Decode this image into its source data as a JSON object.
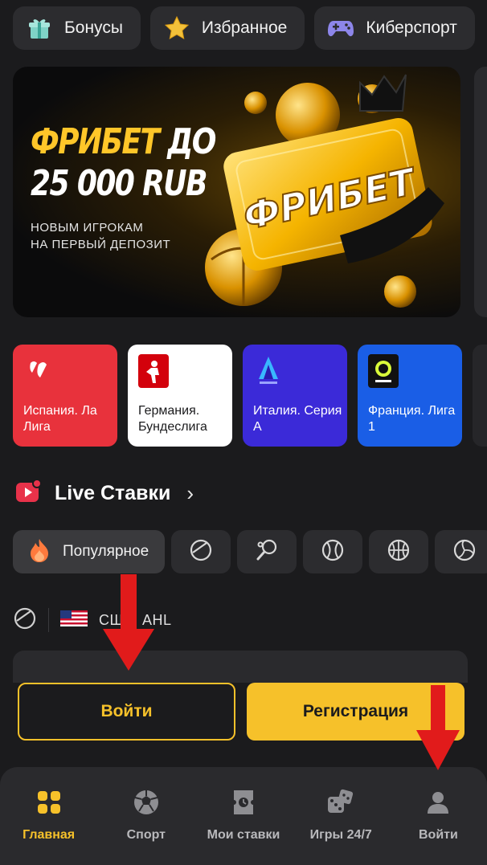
{
  "top_chips": [
    {
      "label": "Бонусы",
      "icon": "gift-icon"
    },
    {
      "label": "Избранное",
      "icon": "star-icon"
    },
    {
      "label": "Киберспорт",
      "icon": "gamepad-icon"
    }
  ],
  "banner": {
    "title_line1_yellow": "ФРИБЕТ",
    "title_line1_white": " ДО",
    "title_line2": "25 000 RUB",
    "subtitle_line1": "НОВЫМ ИГРОКАМ",
    "subtitle_line2": "НА ПЕРВЫЙ ДЕПОЗИТ",
    "art_text": "ФРИБЕТ"
  },
  "leagues": [
    {
      "name": "Испания. Ла Лига",
      "color": "#e8323c"
    },
    {
      "name": "Германия. Бундеслига",
      "color": "#ffffff"
    },
    {
      "name": "Италия. Серия А",
      "color": "#3b2ad8"
    },
    {
      "name": "Франция. Лига 1",
      "color": "#1a5ee6"
    }
  ],
  "live": {
    "title": "Live Ставки",
    "chevron": "›"
  },
  "sport_filters": {
    "active_label": "Популярное",
    "icons": [
      "fire-icon",
      "hockey-puck-icon",
      "table-tennis-icon",
      "tennis-ball-icon",
      "basketball-icon",
      "volleyball-icon"
    ]
  },
  "match": {
    "league": "США. AHL"
  },
  "auth": {
    "login_label": "Войти",
    "register_label": "Регистрация"
  },
  "bottom_nav": [
    {
      "label": "Главная",
      "icon": "home-grid-icon",
      "active": true
    },
    {
      "label": "Спорт",
      "icon": "soccer-ball-icon"
    },
    {
      "label": "Мои ставки",
      "icon": "ticket-icon"
    },
    {
      "label": "Игры 24/7",
      "icon": "dice-icon"
    },
    {
      "label": "Войти",
      "icon": "user-icon"
    }
  ],
  "colors": {
    "background": "#1b1b1d",
    "surface": "#2c2c2f",
    "accent": "#f6c12a",
    "annotation_red": "#e11b1b"
  }
}
